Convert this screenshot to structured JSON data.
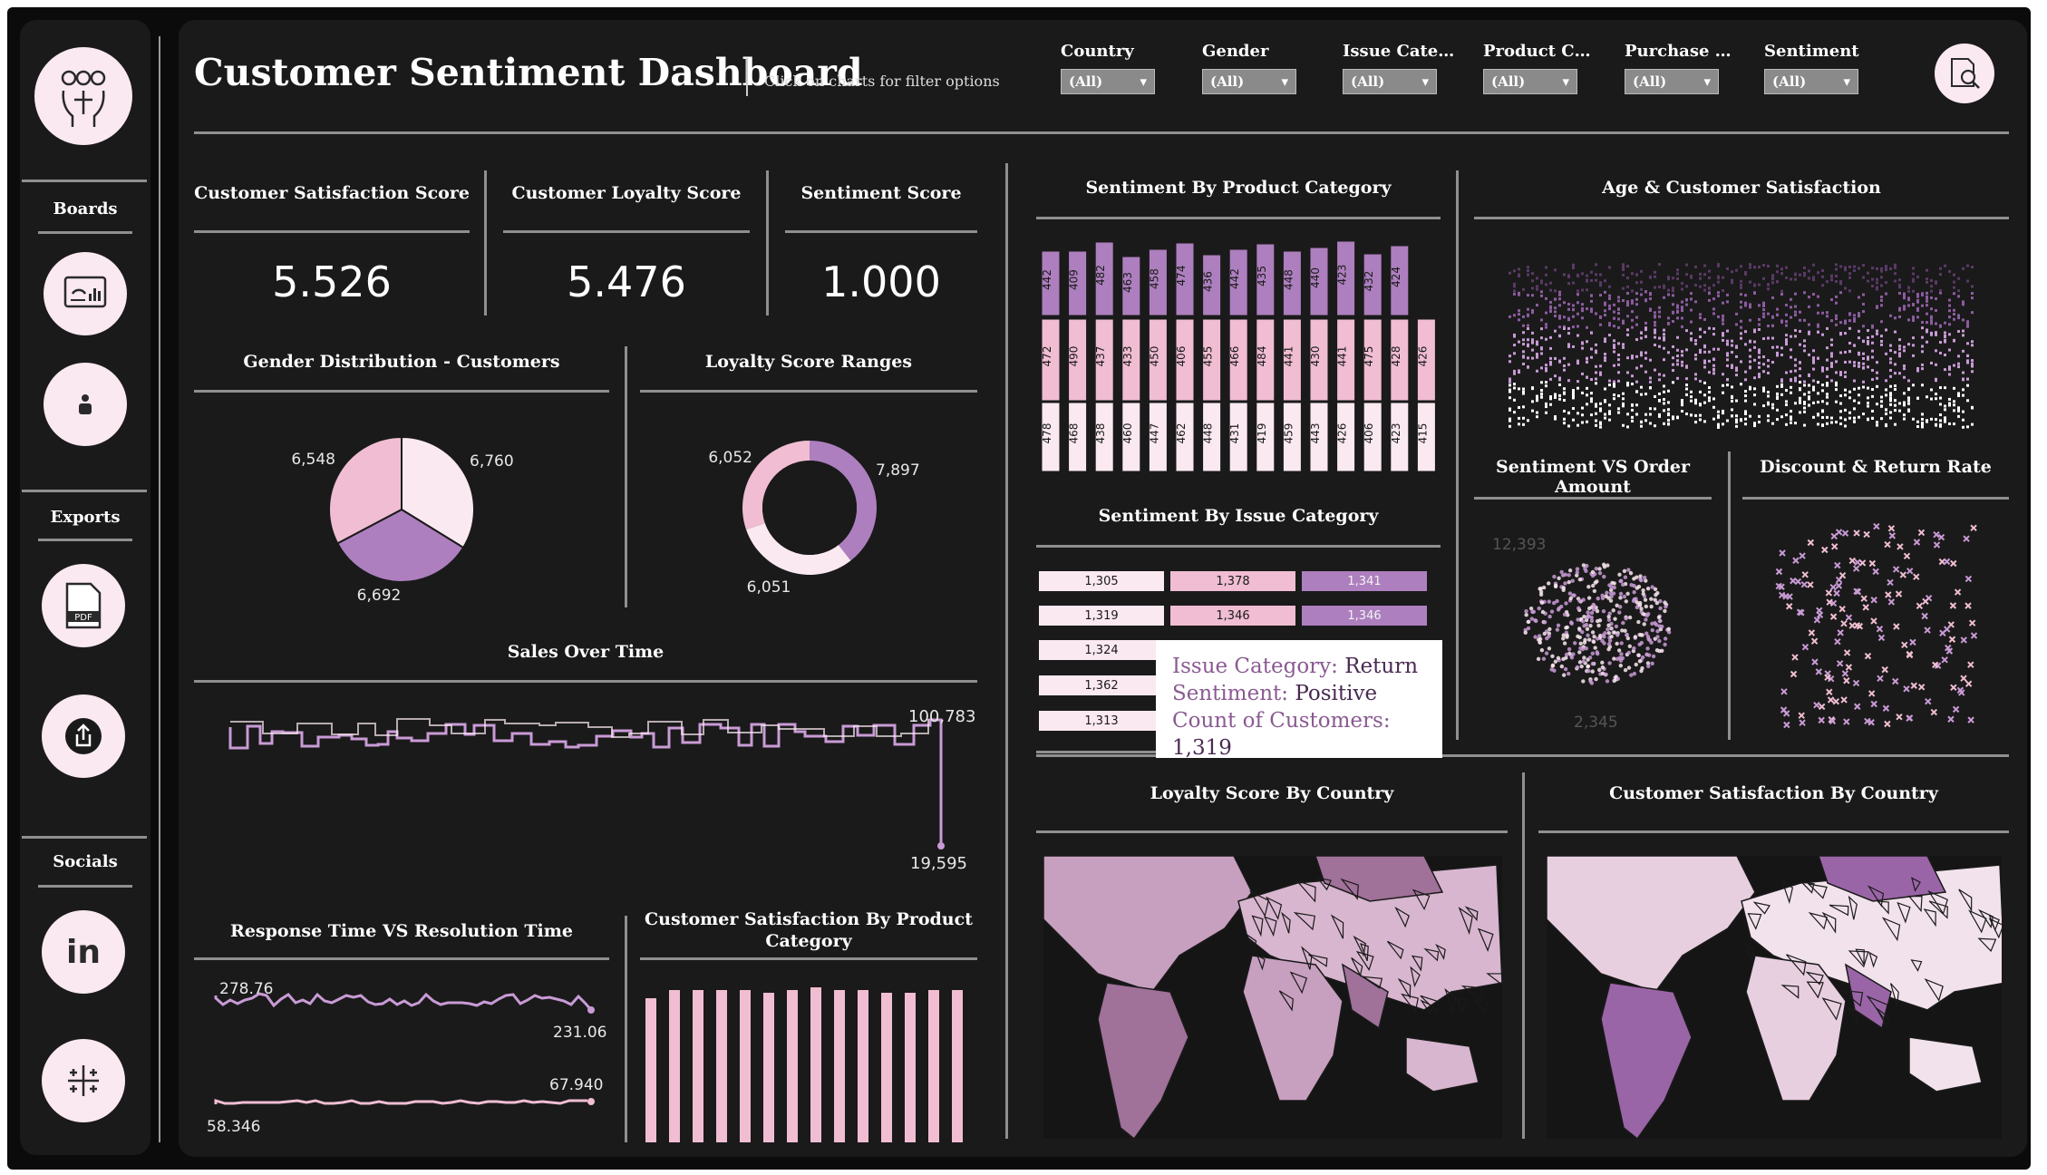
{
  "header": {
    "title": "Customer Sentiment Dashboard",
    "hint": "Click on charts for filter options"
  },
  "filters": [
    {
      "label": "Country",
      "value": "(All)"
    },
    {
      "label": "Gender",
      "value": "(All)"
    },
    {
      "label": "Issue Cate…",
      "value": "(All)"
    },
    {
      "label": "Product C…",
      "value": "(All)"
    },
    {
      "label": "Purchase …",
      "value": "(All)"
    },
    {
      "label": "Sentiment",
      "value": "(All)"
    }
  ],
  "sidebar": {
    "boards_label": "Boards",
    "exports_label": "Exports",
    "socials_label": "Socials",
    "linkedin_text": "in",
    "pdf_text": "PDF"
  },
  "kpis": [
    {
      "title": "Customer Satisfaction Score",
      "value": "5.526"
    },
    {
      "title": "Customer Loyalty Score",
      "value": "5.476"
    },
    {
      "title": "Sentiment Score",
      "value": "1.000"
    }
  ],
  "colors": {
    "light": "#fbe9f1",
    "mid": "#f0bdd2",
    "dark": "#ad7fbe",
    "accent": "#c99bd6",
    "background": "#1a1a1a"
  },
  "chart_data": [
    {
      "type": "pie",
      "title": "Gender Distribution - Customers",
      "values": [
        6760,
        6692,
        6548
      ],
      "value_labels": [
        "6,760",
        "6,692",
        "6,548"
      ]
    },
    {
      "type": "pie",
      "title": "Loyalty Score Ranges",
      "donut": true,
      "values": [
        7897,
        6051,
        6052
      ],
      "value_labels": [
        "7,897",
        "6,051",
        "6,052"
      ]
    },
    {
      "type": "line",
      "title": "Sales Over Time",
      "annotations": [
        {
          "text": "100,783",
          "value": 100783
        },
        {
          "text": "19,595",
          "value": 19595
        }
      ]
    },
    {
      "type": "line",
      "title": "Response Time VS Resolution Time",
      "series": [
        {
          "start_label": "278.76",
          "end_label": "231.06"
        },
        {
          "start_label": "58.346",
          "end_label": "67.940"
        }
      ]
    },
    {
      "type": "bar",
      "title": "Customer Satisfaction By Product Category",
      "values": [
        5.3,
        5.6,
        5.6,
        5.6,
        5.6,
        5.5,
        5.6,
        5.7,
        5.6,
        5.6,
        5.5,
        5.5,
        5.6,
        5.6
      ]
    },
    {
      "type": "bar",
      "title": "Sentiment By Product Category",
      "stacked": true,
      "series": [
        {
          "values": [
            442,
            409,
            482,
            463,
            458,
            474,
            436,
            442,
            435,
            448,
            440,
            423,
            432,
            424
          ]
        },
        {
          "values": [
            472,
            490,
            437,
            433,
            450,
            406,
            455,
            466,
            484,
            441,
            430,
            441,
            475,
            428,
            426
          ]
        },
        {
          "values": [
            478,
            468,
            438,
            460,
            447,
            462,
            448,
            431,
            419,
            459,
            443,
            426,
            406,
            423,
            415
          ]
        }
      ]
    },
    {
      "type": "bar",
      "title": "Sentiment By Issue Category",
      "stacked": true,
      "rows": [
        {
          "values": [
            1305,
            1378,
            1341
          ],
          "labels": [
            "1,305",
            "1,378",
            "1,341"
          ]
        },
        {
          "values": [
            1319,
            1346,
            1346
          ],
          "labels": [
            "1,319",
            "1,346",
            "1,346"
          ]
        },
        {
          "values": [
            1324
          ],
          "labels": [
            "1,324"
          ]
        },
        {
          "values": [
            1362
          ],
          "labels": [
            "1,362"
          ]
        },
        {
          "values": [
            1313
          ],
          "labels": [
            "1,313"
          ]
        }
      ],
      "tooltip": {
        "rows": [
          {
            "key": "Issue Category:",
            "value": "Return"
          },
          {
            "key": "Sentiment:",
            "value": "Positive"
          },
          {
            "key": "Count of Customers:",
            "value": "1,319"
          }
        ]
      }
    },
    {
      "type": "scatter",
      "title": "Age & Customer Satisfaction"
    },
    {
      "type": "scatter",
      "title": "Sentiment VS Order Amount",
      "annotations": [
        "12,393",
        "2,345"
      ]
    },
    {
      "type": "scatter",
      "title": "Discount & Return Rate"
    },
    {
      "type": "heatmap",
      "title": "Loyalty Score By Country"
    },
    {
      "type": "heatmap",
      "title": "Customer Satisfaction By Country"
    }
  ]
}
